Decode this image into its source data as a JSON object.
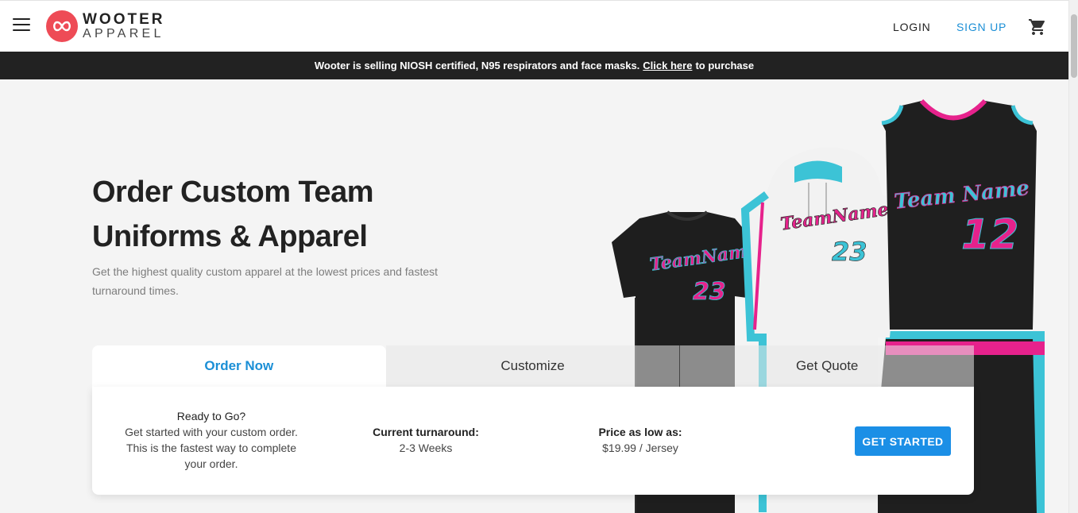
{
  "header": {
    "logo_line1": "WOOTER",
    "logo_line2": "APPAREL",
    "login": "LOGIN",
    "signup": "SIGN UP"
  },
  "announcement": {
    "text_before": "Wooter is selling NIOSH certified, N95 respirators and face masks.",
    "link": "Click here",
    "text_after": "to purchase"
  },
  "hero": {
    "title": "Order Custom Team Uniforms & Apparel",
    "subtitle": "Get the highest quality custom apparel at the lowest prices and fastest turnaround times."
  },
  "apparel": {
    "shirt_name": "TeamName",
    "shirt_number": "23",
    "hoodie_name": "TeamName",
    "hoodie_number": "23",
    "jersey_name": "Team Name",
    "jersey_number": "12"
  },
  "tabs": [
    {
      "label": "Order Now",
      "active": true
    },
    {
      "label": "Customize",
      "active": false
    },
    {
      "label": "Get Quote",
      "active": false
    }
  ],
  "order_card": {
    "ready_title": "Ready to Go?",
    "ready_text": "Get started with your custom order. This is the fastest way to complete your order.",
    "turnaround_label": "Current turnaround:",
    "turnaround_value": "2-3 Weeks",
    "price_label": "Price as low as:",
    "price_value": "$19.99 / Jersey",
    "cta": "GET STARTED"
  },
  "colors": {
    "brand_red": "#ee4b56",
    "accent_blue": "#1b8fd6",
    "button_blue": "#1b8fe6",
    "announcement_bg": "#222222",
    "apparel_pink": "#e6228c",
    "apparel_teal": "#3cc3d6"
  },
  "icons": [
    "menu-icon",
    "wooter-logo-icon",
    "cart-icon"
  ]
}
